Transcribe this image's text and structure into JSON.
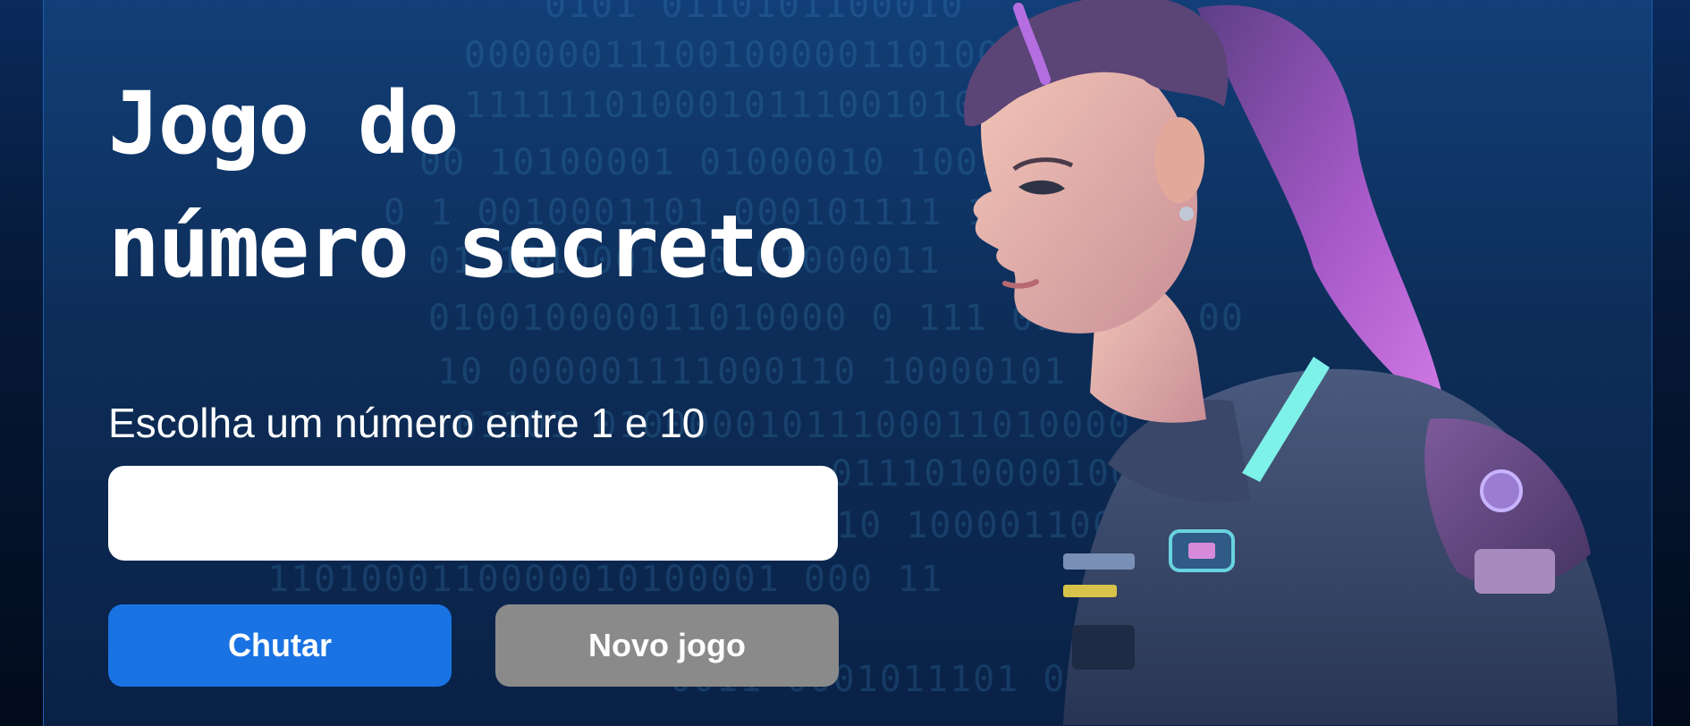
{
  "page": {
    "title_line1": "Jogo do",
    "title_line2": "número secreto",
    "prompt": "Escolha um número entre 1 e 10",
    "input": {
      "value": "",
      "placeholder": ""
    }
  },
  "buttons": {
    "guess_label": "Chutar",
    "new_game_label": "Novo jogo"
  },
  "background": {
    "binary_rows": [
      "0101 0110101100010",
      "0000001110010000011010000100",
      "1111110100010111001010 1 0",
      "00 10100001 01000010 1001011",
      "0 1 0010001101 000101111 1",
      "01 10100011 0 01000011",
      "010010000011010000 0 111 0100011 00",
      "10 000001111000110 10000101",
      "01101 01000001011100011010000",
      "0111010000100111",
      "110 10000110001010 101110",
      "1101000110000010100001 000 11",
      "0011 0001011101 0000 0110"
    ]
  },
  "colors": {
    "accent": "#1a73e3",
    "secondary": "#8a8a8a",
    "background_top": "#123f78",
    "background_bottom": "#0a2146"
  }
}
